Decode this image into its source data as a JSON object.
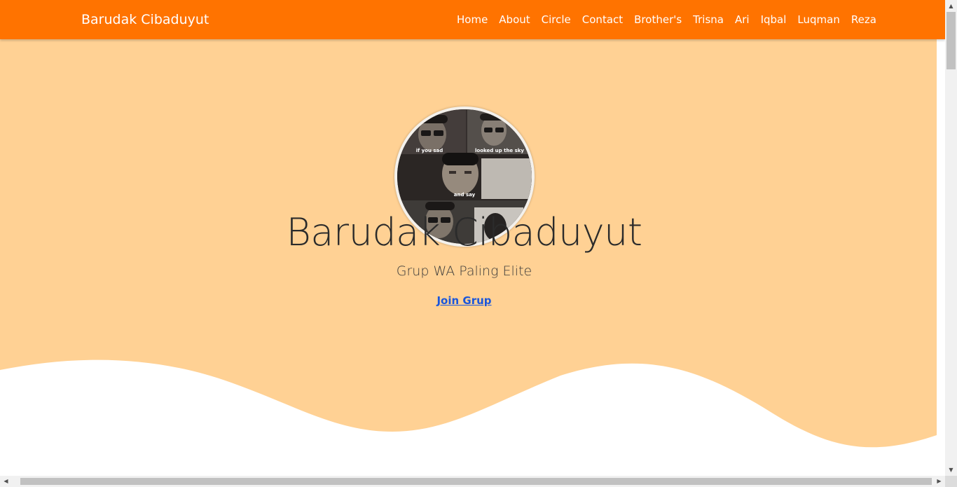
{
  "navbar": {
    "brand": "Barudak Cibaduyut",
    "links": [
      "Home",
      "About",
      "Circle",
      "Contact",
      "Brother's",
      "Trisna",
      "Ari",
      "Iqbal",
      "Luqman",
      "Reza"
    ]
  },
  "hero": {
    "avatar_captions": [
      "if you sad",
      "looked up the sky",
      "and say"
    ],
    "title": "Barudak Cibaduyut",
    "subtitle": "Grup WA Paling Elite",
    "link_label": "Join Grup"
  },
  "colors": {
    "navbar_bg": "#ff7300",
    "hero_bg": "#ffd194",
    "link": "#1a56db"
  }
}
